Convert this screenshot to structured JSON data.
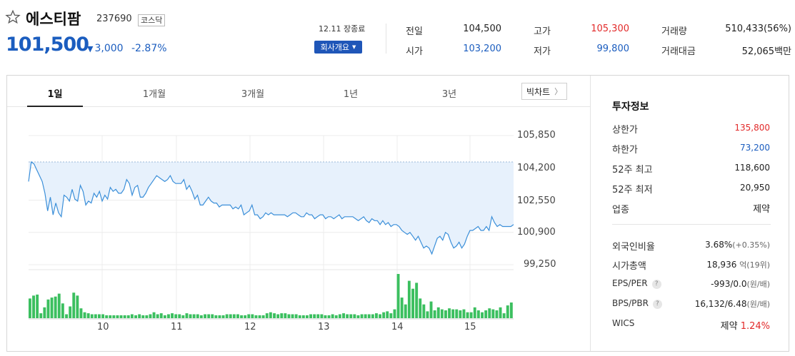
{
  "header": {
    "name": "에스티팜",
    "code": "237690",
    "market": "코스닥",
    "price": "101,500",
    "change": "3,000",
    "change_pct": "-2.87%",
    "date_note": "12.11 장종료",
    "company_button": "회사개요"
  },
  "quote": {
    "prev_close_label": "전일",
    "prev_close": "104,500",
    "high_label": "고가",
    "high": "105,300",
    "volume_label": "거래량",
    "volume": "510,433(56%)",
    "open_label": "시가",
    "open": "103,200",
    "low_label": "저가",
    "low": "99,800",
    "amount_label": "거래대금",
    "amount": "52,065백만"
  },
  "tabs": [
    {
      "label": "1일",
      "active": true
    },
    {
      "label": "1개월",
      "active": false
    },
    {
      "label": "3개월",
      "active": false
    },
    {
      "label": "1년",
      "active": false
    },
    {
      "label": "3년",
      "active": false
    }
  ],
  "big_chart_button": "빅차트",
  "chart_data": {
    "type": "area",
    "y_ticks": [
      "105,850",
      "104,200",
      "102,550",
      "100,900",
      "99,250"
    ],
    "y_tick_values": [
      105850,
      104200,
      102550,
      100900,
      99250
    ],
    "ylim": [
      99250,
      105850
    ],
    "x_ticks": [
      "10",
      "11",
      "12",
      "13",
      "14",
      "15"
    ],
    "reference_price": 104500,
    "price": [
      103500,
      104500,
      104400,
      104100,
      103800,
      103500,
      102900,
      102000,
      102700,
      101800,
      102400,
      101900,
      101700,
      102800,
      102700,
      102500,
      103100,
      102600,
      102500,
      103300,
      103000,
      102300,
      102500,
      102400,
      102900,
      102700,
      103000,
      102500,
      102800,
      102600,
      103200,
      103000,
      103100,
      102900,
      102900,
      103100,
      103600,
      103400,
      102800,
      103200,
      103300,
      102700,
      102700,
      102900,
      103200,
      103400,
      103600,
      103800,
      103700,
      103600,
      103500,
      103600,
      103800,
      103500,
      103400,
      103400,
      103400,
      103600,
      103100,
      103300,
      103000,
      102600,
      102800,
      102300,
      102300,
      102500,
      102700,
      102500,
      102400,
      102400,
      102200,
      102300,
      102300,
      102300,
      102300,
      102100,
      102200,
      102100,
      102300,
      101800,
      101900,
      102000,
      102300,
      101800,
      101800,
      101600,
      101700,
      101900,
      101800,
      101900,
      101800,
      101800,
      101800,
      101800,
      101800,
      101700,
      101800,
      101900,
      101900,
      101800,
      101700,
      101700,
      101900,
      101800,
      101800,
      101600,
      101700,
      101800,
      101800,
      101600,
      101700,
      101700,
      101600,
      101700,
      101800,
      101600,
      101700,
      101700,
      101700,
      101700,
      101600,
      101500,
      101600,
      101700,
      101500,
      101400,
      101600,
      101500,
      101500,
      101300,
      101500,
      101300,
      101400,
      101200,
      101300,
      101300,
      101200,
      101000,
      100900,
      100800,
      100900,
      100700,
      100500,
      100700,
      100400,
      100100,
      100200,
      100100,
      99800,
      100200,
      100600,
      100700,
      100500,
      100900,
      100800,
      100400,
      100100,
      100200,
      100400,
      100100,
      100300,
      100700,
      101000,
      101000,
      101100,
      101200,
      101000,
      101000,
      101200,
      101000,
      101700,
      101400,
      101200,
      101300,
      101200,
      101200,
      101200,
      101200,
      101300
    ],
    "volume": [
      20,
      23,
      24,
      5,
      11,
      19,
      21,
      22,
      25,
      15,
      4,
      12,
      26,
      23,
      10,
      6,
      5,
      4,
      4,
      4,
      4,
      3,
      3,
      3,
      3,
      3,
      3,
      3,
      4,
      3,
      4,
      3,
      3,
      4,
      6,
      4,
      5,
      3,
      4,
      5,
      4,
      4,
      3,
      5,
      4,
      4,
      4,
      3,
      4,
      4,
      4,
      3,
      3,
      3,
      4,
      4,
      4,
      4,
      3,
      3,
      4,
      4,
      3,
      3,
      3,
      5,
      6,
      5,
      4,
      5,
      5,
      4,
      4,
      4,
      3,
      3,
      3,
      4,
      4,
      4,
      4,
      3,
      3,
      4,
      3,
      4,
      5,
      4,
      4,
      4,
      3,
      4,
      4,
      4,
      4,
      5,
      4,
      6,
      7,
      5,
      9,
      45,
      21,
      14,
      38,
      30,
      36,
      20,
      14,
      7,
      17,
      8,
      11,
      9,
      8,
      10,
      9,
      9,
      8,
      9,
      6,
      6,
      11,
      8,
      6,
      8,
      10,
      9,
      8,
      11,
      5,
      13,
      16
    ]
  },
  "invest_info": {
    "title": "투자정보",
    "rows": [
      {
        "label": "상한가",
        "value": "135,800",
        "color": "red"
      },
      {
        "label": "하한가",
        "value": "73,200",
        "color": "blue"
      },
      {
        "label": "52주 최고",
        "value": "118,600",
        "color": "dark"
      },
      {
        "label": "52주 최저",
        "value": "20,950",
        "color": "dark"
      },
      {
        "label": "업종",
        "value": "제약",
        "color": "dark"
      }
    ],
    "foreign_label": "외국인비율",
    "foreign_value": "3.68%",
    "foreign_sub": "(+0.35%)",
    "mktcap_label": "시가총액",
    "mktcap_value": "18,936",
    "mktcap_sub": "억(19위)",
    "eps_label": "EPS/PER",
    "eps_value": "-993/0.0",
    "eps_sub": "(원/배)",
    "bps_label": "BPS/PBR",
    "bps_value": "16,132/6.48",
    "bps_sub": "(원/배)",
    "wics_label": "WICS",
    "wics_sector": "제약",
    "wics_pct": "1.24%",
    "help_glyph": "?"
  },
  "colors": {
    "up": "#e22a2a",
    "down": "#1b5dbf",
    "line": "#3b8fd9",
    "area": "#e7f1fc",
    "volume": "#3bbf5f",
    "button": "#1f56b8"
  },
  "icons": {
    "favorite": "star-outline-icon",
    "down_arrow": "triangle-down-icon",
    "caret": "caret-down-icon",
    "chevron": "chevron-right-icon"
  }
}
